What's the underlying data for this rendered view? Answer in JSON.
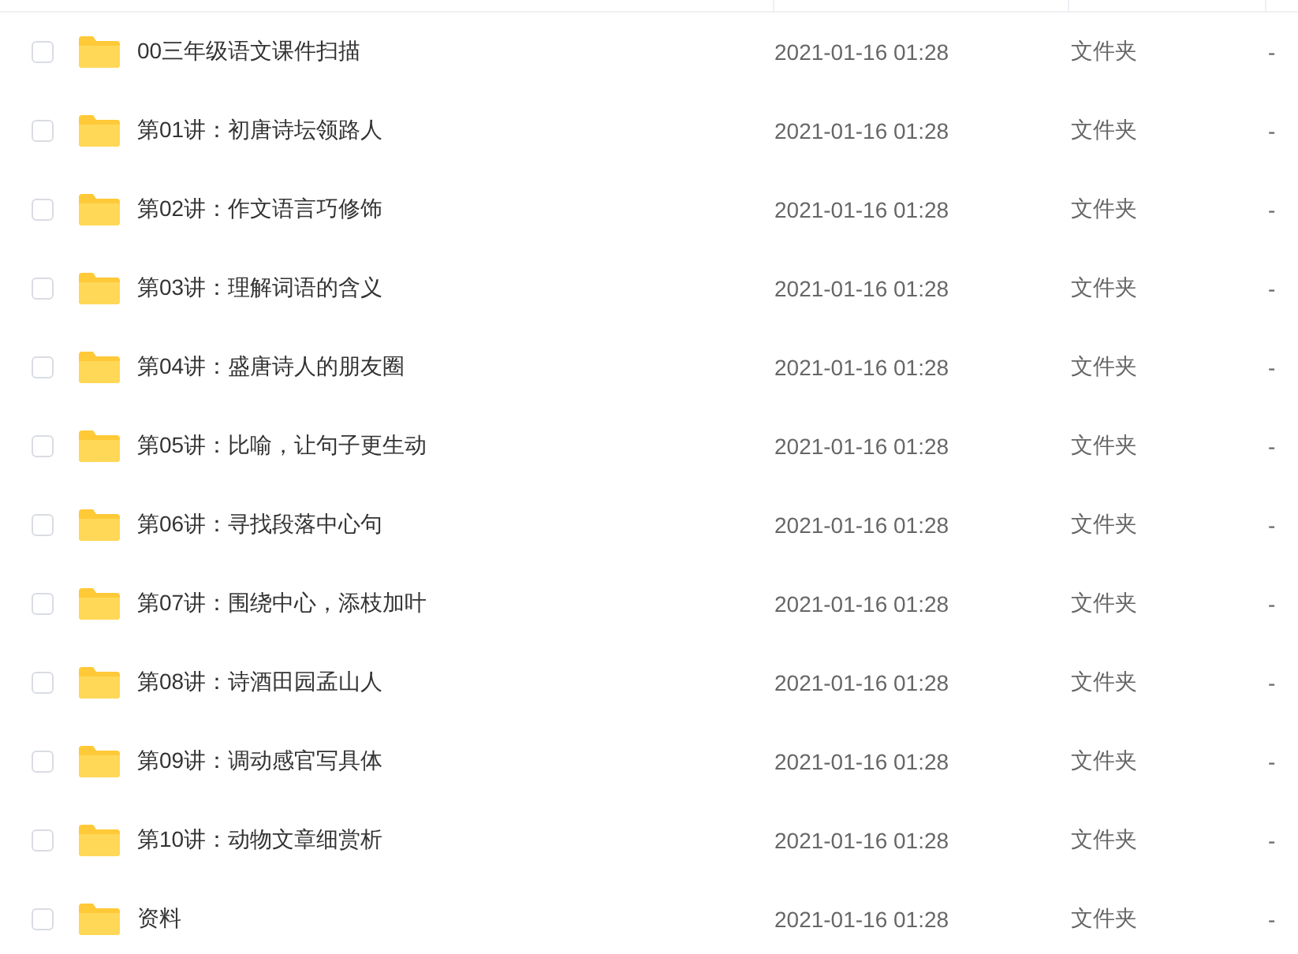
{
  "files": [
    {
      "name": "00三年级语文课件扫描",
      "modified": "2021-01-16 01:28",
      "type": "文件夹",
      "size": "-",
      "checked": false
    },
    {
      "name": "第01讲：初唐诗坛领路人",
      "modified": "2021-01-16 01:28",
      "type": "文件夹",
      "size": "-",
      "checked": false
    },
    {
      "name": "第02讲：作文语言巧修饰",
      "modified": "2021-01-16 01:28",
      "type": "文件夹",
      "size": "-",
      "checked": false
    },
    {
      "name": "第03讲：理解词语的含义",
      "modified": "2021-01-16 01:28",
      "type": "文件夹",
      "size": "-",
      "checked": false
    },
    {
      "name": "第04讲：盛唐诗人的朋友圈",
      "modified": "2021-01-16 01:28",
      "type": "文件夹",
      "size": "-",
      "checked": false
    },
    {
      "name": "第05讲：比喻，让句子更生动",
      "modified": "2021-01-16 01:28",
      "type": "文件夹",
      "size": "-",
      "checked": false
    },
    {
      "name": "第06讲：寻找段落中心句",
      "modified": "2021-01-16 01:28",
      "type": "文件夹",
      "size": "-",
      "checked": false
    },
    {
      "name": "第07讲：围绕中心，添枝加叶",
      "modified": "2021-01-16 01:28",
      "type": "文件夹",
      "size": "-",
      "checked": false
    },
    {
      "name": "第08讲：诗酒田园孟山人",
      "modified": "2021-01-16 01:28",
      "type": "文件夹",
      "size": "-",
      "checked": false
    },
    {
      "name": "第09讲：调动感官写具体",
      "modified": "2021-01-16 01:28",
      "type": "文件夹",
      "size": "-",
      "checked": false
    },
    {
      "name": "第10讲：动物文章细赏析",
      "modified": "2021-01-16 01:28",
      "type": "文件夹",
      "size": "-",
      "checked": false
    },
    {
      "name": "资料",
      "modified": "2021-01-16 01:28",
      "type": "文件夹",
      "size": "-",
      "checked": false
    }
  ]
}
